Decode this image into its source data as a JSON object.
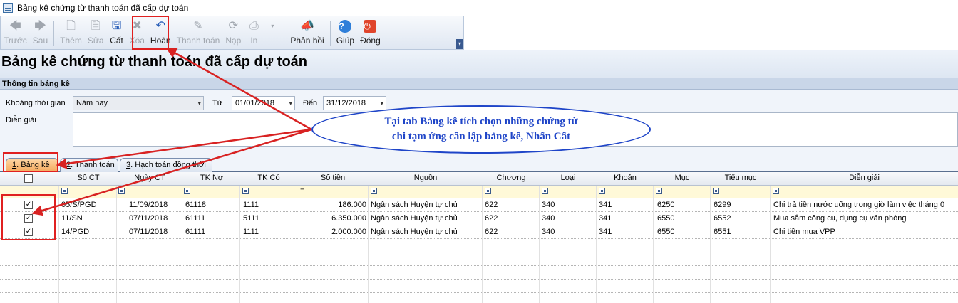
{
  "window": {
    "title": "Bảng kê chứng từ thanh toán đã cấp dự toán"
  },
  "toolbar": {
    "buttons": [
      {
        "label": "Trước",
        "icon": "arrow-left-icon",
        "enabled": false
      },
      {
        "label": "Sau",
        "icon": "arrow-right-icon",
        "enabled": false
      },
      {
        "label": "Thêm",
        "icon": "add-document-icon",
        "enabled": false
      },
      {
        "label": "Sửa",
        "icon": "edit-document-icon",
        "enabled": false
      },
      {
        "label": "Cất",
        "icon": "save-icon",
        "enabled": true
      },
      {
        "label": "Xóa",
        "icon": "delete-icon",
        "enabled": false
      },
      {
        "label": "Hoãn",
        "icon": "undo-icon",
        "enabled": true
      },
      {
        "label": "Thanh toán",
        "icon": "pen-icon",
        "enabled": false
      },
      {
        "label": "Nạp",
        "icon": "reload-icon",
        "enabled": false
      },
      {
        "label": "In",
        "icon": "printer-icon",
        "enabled": false
      },
      {
        "label": "Phản hồi",
        "icon": "megaphone-icon",
        "enabled": true
      },
      {
        "label": "Giúp",
        "icon": "help-icon",
        "enabled": true
      },
      {
        "label": "Đóng",
        "icon": "power-icon",
        "enabled": true
      }
    ]
  },
  "page": {
    "heading": "Bảng kê chứng từ thanh toán đã cấp dự toán"
  },
  "info_section": {
    "title": "Thông tin bảng kê",
    "period_label": "Khoảng thời gian",
    "period_value": "Năm nay",
    "from_label": "Từ",
    "from_value": "01/01/2018",
    "to_label": "Đến",
    "to_value": "31/12/2018",
    "description_label": "Diễn giải",
    "description_value": ""
  },
  "tabs": [
    {
      "key": "1",
      "label": ". Bảng kê",
      "active": true
    },
    {
      "key": "2",
      "label": ". Thanh toán",
      "active": false
    },
    {
      "key": "3",
      "label": ". Hạch toán đồng thời",
      "active": false
    }
  ],
  "grid": {
    "columns": [
      "Số CT",
      "Ngày CT",
      "TK Nợ",
      "TK Có",
      "Số tiền",
      "Nguồn",
      "Chương",
      "Loại",
      "Khoản",
      "Mục",
      "Tiểu mục",
      "Diễn giải"
    ],
    "filter_eq": "=",
    "rows": [
      {
        "checked": true,
        "so_ct": "05/S/PGD",
        "ngay_ct": "11/09/2018",
        "tk_no": "61118",
        "tk_co": "1111",
        "so_tien": "186.000",
        "nguon": "Ngân sách Huyện tự chủ",
        "chuong": "622",
        "loai": "340",
        "khoan": "341",
        "muc": "6250",
        "tieu_muc": "6299",
        "dien_giai": "Chi trả tiền nước uống trong giờ làm việc tháng 0"
      },
      {
        "checked": true,
        "so_ct": "11/SN",
        "ngay_ct": "07/11/2018",
        "tk_no": "61111",
        "tk_co": "5111",
        "so_tien": "6.350.000",
        "nguon": "Ngân sách Huyện tự chủ",
        "chuong": "622",
        "loai": "340",
        "khoan": "341",
        "muc": "6550",
        "tieu_muc": "6552",
        "dien_giai": "Mua sắm công cụ, dụng cụ văn phòng"
      },
      {
        "checked": true,
        "so_ct": "14/PGD",
        "ngay_ct": "07/11/2018",
        "tk_no": "61111",
        "tk_co": "1111",
        "so_tien": "2.000.000",
        "nguon": "Ngân sách Huyện tự chủ",
        "chuong": "622",
        "loai": "340",
        "khoan": "341",
        "muc": "6550",
        "tieu_muc": "6551",
        "dien_giai": "Chi tiền mua VPP"
      }
    ]
  },
  "callout": {
    "line1": "Tại tab Bảng kê tích chọn những chứng từ",
    "line2": "chi tạm ứng cần lập bảng kê, Nhấn Cất"
  },
  "colors": {
    "highlight": "#e02020",
    "callout": "#1f45c8",
    "active_tab": "#f4a85b"
  }
}
